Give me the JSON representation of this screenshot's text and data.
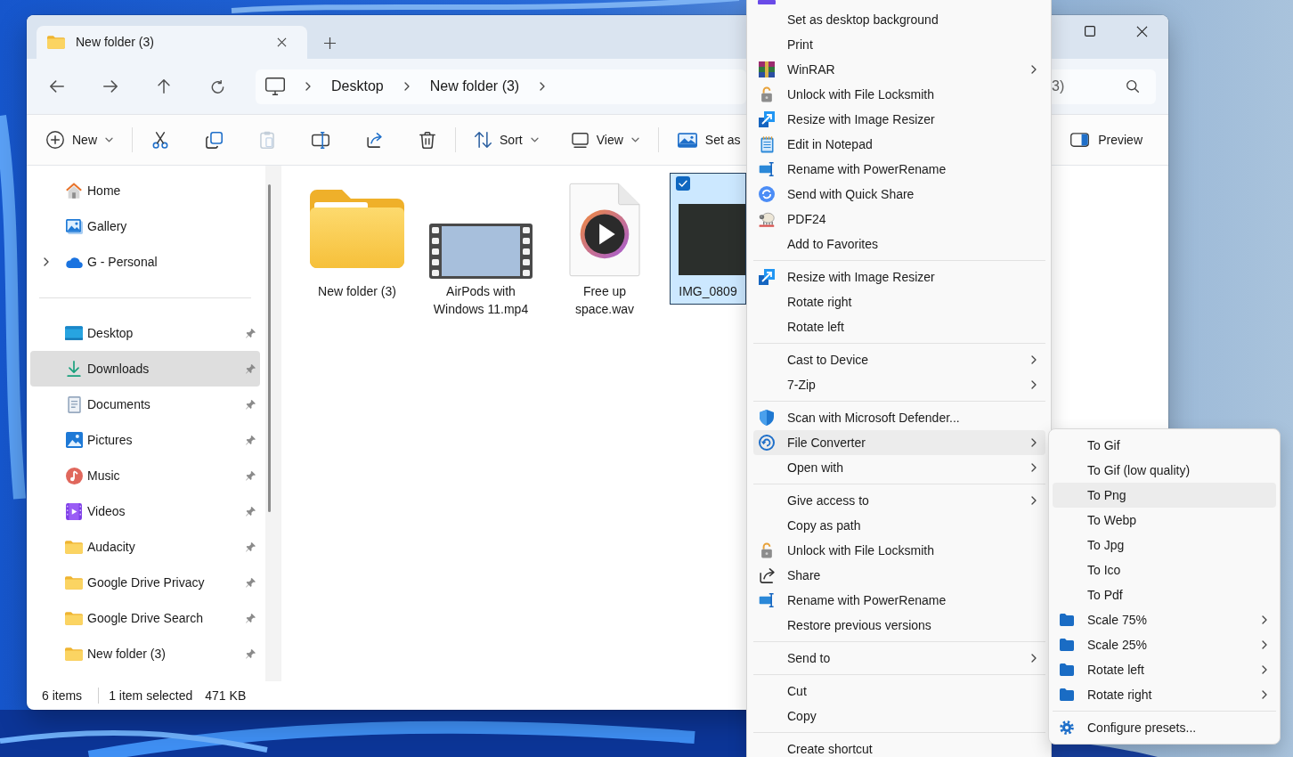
{
  "explorer": {
    "tab": {
      "title": "New folder (3)"
    },
    "breadcrumb": [
      {
        "label": "Desktop"
      },
      {
        "label": "New folder (3)"
      }
    ],
    "search": {
      "placeholder": "3)"
    },
    "toolbar": {
      "groups": [
        {
          "items": [
            {
              "kind": "new",
              "label": "New",
              "dropdown": true,
              "disabled": false
            }
          ]
        },
        {
          "items": [
            {
              "kind": "cut",
              "dropdown": false,
              "disabled": false
            },
            {
              "kind": "copy",
              "dropdown": false,
              "disabled": false
            },
            {
              "kind": "paste",
              "dropdown": false,
              "disabled": true
            },
            {
              "kind": "rename",
              "dropdown": false,
              "disabled": false
            },
            {
              "kind": "share",
              "dropdown": false,
              "disabled": false
            },
            {
              "kind": "delete",
              "dropdown": false,
              "disabled": false
            }
          ]
        },
        {
          "items": [
            {
              "kind": "sort",
              "label": "Sort",
              "dropdown": true,
              "disabled": false
            },
            {
              "kind": "view",
              "label": "View",
              "dropdown": true,
              "disabled": false
            }
          ]
        },
        {
          "items": [
            {
              "kind": "background",
              "label": "Set as",
              "dropdown": false,
              "disabled": false
            }
          ]
        }
      ],
      "preview": {
        "label": "Preview"
      }
    },
    "sidebar": {
      "sections": [
        {
          "items": [
            {
              "label": "Home",
              "kind": "home",
              "expandable": false,
              "pinned": false,
              "selected": false
            },
            {
              "label": "Gallery",
              "kind": "gallery",
              "expandable": false,
              "pinned": false,
              "selected": false
            },
            {
              "label": "G - Personal",
              "kind": "cloud",
              "expandable": true,
              "pinned": false,
              "selected": false
            }
          ]
        },
        {
          "items": [
            {
              "label": "Desktop",
              "kind": "desktop",
              "expandable": false,
              "pinned": true,
              "selected": false
            },
            {
              "label": "Downloads",
              "kind": "downloads",
              "expandable": false,
              "pinned": true,
              "selected": true
            },
            {
              "label": "Documents",
              "kind": "documents",
              "expandable": false,
              "pinned": true,
              "selected": false
            },
            {
              "label": "Pictures",
              "kind": "pictures",
              "expandable": false,
              "pinned": true,
              "selected": false
            },
            {
              "label": "Music",
              "kind": "music",
              "expandable": false,
              "pinned": true,
              "selected": false
            },
            {
              "label": "Videos",
              "kind": "videos",
              "expandable": false,
              "pinned": true,
              "selected": false
            },
            {
              "label": "Audacity",
              "kind": "folder",
              "expandable": false,
              "pinned": true,
              "selected": false
            },
            {
              "label": "Google Drive Privacy",
              "kind": "folder",
              "expandable": false,
              "pinned": true,
              "selected": false
            },
            {
              "label": "Google Drive Search",
              "kind": "folder",
              "expandable": false,
              "pinned": true,
              "selected": false
            },
            {
              "label": "New folder (3)",
              "kind": "folder",
              "expandable": false,
              "pinned": true,
              "selected": false
            }
          ]
        }
      ]
    },
    "files": [
      {
        "name": "New folder (3)",
        "kind": "folder",
        "selected": false
      },
      {
        "name": "AirPods with Windows 11.mp4",
        "kind": "video",
        "selected": false
      },
      {
        "name": "Free up space.wav",
        "kind": "audio",
        "selected": false
      },
      {
        "name": "IMG_0809",
        "kind": "image",
        "selected": true
      }
    ],
    "status_bar": {
      "item_count": "6 items",
      "selection": "1 item selected",
      "size": "471 KB"
    }
  },
  "context_menu": {
    "groups": [
      {
        "items": [
          {
            "kind": "app",
            "submenu": false,
            "selected": false
          },
          {
            "label": "Set as desktop background",
            "kind": "plain",
            "submenu": false,
            "selected": false
          },
          {
            "label": "Print",
            "kind": "plain",
            "submenu": false,
            "selected": false
          },
          {
            "label": "WinRAR",
            "kind": "winrar",
            "submenu": true,
            "selected": false
          },
          {
            "label": "Unlock with File Locksmith",
            "kind": "lock",
            "submenu": false,
            "selected": false
          },
          {
            "label": "Resize with Image Resizer",
            "kind": "resizer",
            "submenu": false,
            "selected": false
          },
          {
            "label": "Edit in Notepad",
            "kind": "notepad",
            "submenu": false,
            "selected": false
          },
          {
            "label": "Rename with PowerRename",
            "kind": "rename",
            "submenu": false,
            "selected": false
          },
          {
            "label": "Send with Quick Share",
            "kind": "quickshare",
            "submenu": false,
            "selected": false
          },
          {
            "label": "PDF24",
            "kind": "pdf24",
            "submenu": false,
            "selected": false
          },
          {
            "label": "Add to Favorites",
            "kind": "plain",
            "submenu": false,
            "selected": false
          }
        ]
      },
      {
        "items": [
          {
            "label": "Resize with Image Resizer",
            "kind": "resizer",
            "submenu": false,
            "selected": false
          },
          {
            "label": "Rotate right",
            "kind": "plain",
            "submenu": false,
            "selected": false
          },
          {
            "label": "Rotate left",
            "kind": "plain",
            "submenu": false,
            "selected": false
          }
        ]
      },
      {
        "items": [
          {
            "label": "Cast to Device",
            "kind": "plain",
            "submenu": true,
            "selected": false
          },
          {
            "label": "7-Zip",
            "kind": "plain",
            "submenu": true,
            "selected": false
          }
        ]
      },
      {
        "items": [
          {
            "label": "Scan with Microsoft Defender...",
            "kind": "defender",
            "submenu": false,
            "selected": false
          },
          {
            "label": "File Converter",
            "kind": "converter",
            "submenu": true,
            "selected": true
          },
          {
            "label": "Open with",
            "kind": "plain",
            "submenu": true,
            "selected": false
          }
        ]
      },
      {
        "items": [
          {
            "label": "Give access to",
            "kind": "plain",
            "submenu": true,
            "selected": false
          },
          {
            "label": "Copy as path",
            "kind": "plain",
            "submenu": false,
            "selected": false
          },
          {
            "label": "Unlock with File Locksmith",
            "kind": "lock",
            "submenu": false,
            "selected": false
          },
          {
            "label": "Share",
            "kind": "share",
            "submenu": false,
            "selected": false
          },
          {
            "label": "Rename with PowerRename",
            "kind": "rename",
            "submenu": false,
            "selected": false
          },
          {
            "label": "Restore previous versions",
            "kind": "plain",
            "submenu": false,
            "selected": false
          }
        ]
      },
      {
        "items": [
          {
            "label": "Send to",
            "kind": "plain",
            "submenu": true,
            "selected": false
          }
        ]
      },
      {
        "items": [
          {
            "label": "Cut",
            "kind": "plain",
            "submenu": false,
            "selected": false
          },
          {
            "label": "Copy",
            "kind": "plain",
            "submenu": false,
            "selected": false
          }
        ]
      },
      {
        "items": [
          {
            "label": "Create shortcut",
            "kind": "plain",
            "submenu": false,
            "selected": false
          }
        ]
      }
    ]
  },
  "submenu": {
    "groups": [
      {
        "items": [
          {
            "label": "To Gif",
            "kind": "plain",
            "submenu": false,
            "selected": false
          },
          {
            "label": "To Gif (low quality)",
            "kind": "plain",
            "submenu": false,
            "selected": false
          },
          {
            "label": "To Png",
            "kind": "plain",
            "submenu": false,
            "selected": true
          },
          {
            "label": "To Webp",
            "kind": "plain",
            "submenu": false,
            "selected": false
          },
          {
            "label": "To Jpg",
            "kind": "plain",
            "submenu": false,
            "selected": false
          },
          {
            "label": "To Ico",
            "kind": "plain",
            "submenu": false,
            "selected": false
          },
          {
            "label": "To Pdf",
            "kind": "plain",
            "submenu": false,
            "selected": false
          },
          {
            "label": "Scale 75%",
            "kind": "folder",
            "submenu": true,
            "selected": false
          },
          {
            "label": "Scale 25%",
            "kind": "folder",
            "submenu": true,
            "selected": false
          },
          {
            "label": "Rotate left",
            "kind": "folder",
            "submenu": true,
            "selected": false
          },
          {
            "label": "Rotate right",
            "kind": "folder",
            "submenu": true,
            "selected": false
          }
        ]
      },
      {
        "items": [
          {
            "label": "Configure presets...",
            "kind": "gear",
            "submenu": false,
            "selected": false
          }
        ]
      }
    ]
  }
}
